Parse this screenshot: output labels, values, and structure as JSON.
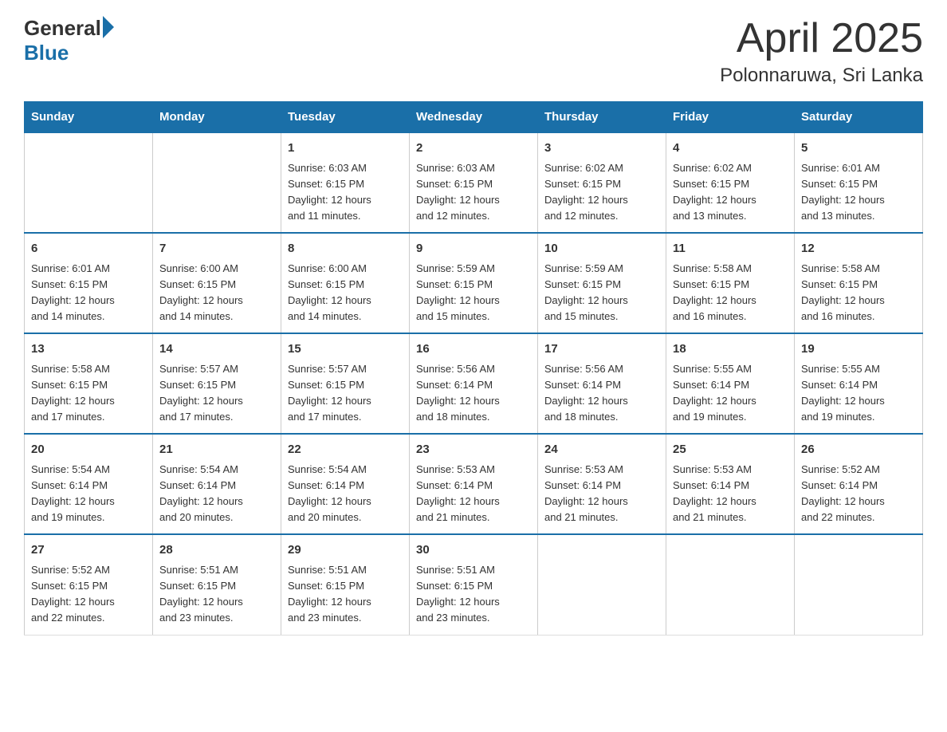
{
  "logo": {
    "text_general": "General",
    "text_blue": "Blue"
  },
  "title": "April 2025",
  "subtitle": "Polonnaruwa, Sri Lanka",
  "days_of_week": [
    "Sunday",
    "Monday",
    "Tuesday",
    "Wednesday",
    "Thursday",
    "Friday",
    "Saturday"
  ],
  "weeks": [
    [
      {
        "day": "",
        "info": ""
      },
      {
        "day": "",
        "info": ""
      },
      {
        "day": "1",
        "info": "Sunrise: 6:03 AM\nSunset: 6:15 PM\nDaylight: 12 hours\nand 11 minutes."
      },
      {
        "day": "2",
        "info": "Sunrise: 6:03 AM\nSunset: 6:15 PM\nDaylight: 12 hours\nand 12 minutes."
      },
      {
        "day": "3",
        "info": "Sunrise: 6:02 AM\nSunset: 6:15 PM\nDaylight: 12 hours\nand 12 minutes."
      },
      {
        "day": "4",
        "info": "Sunrise: 6:02 AM\nSunset: 6:15 PM\nDaylight: 12 hours\nand 13 minutes."
      },
      {
        "day": "5",
        "info": "Sunrise: 6:01 AM\nSunset: 6:15 PM\nDaylight: 12 hours\nand 13 minutes."
      }
    ],
    [
      {
        "day": "6",
        "info": "Sunrise: 6:01 AM\nSunset: 6:15 PM\nDaylight: 12 hours\nand 14 minutes."
      },
      {
        "day": "7",
        "info": "Sunrise: 6:00 AM\nSunset: 6:15 PM\nDaylight: 12 hours\nand 14 minutes."
      },
      {
        "day": "8",
        "info": "Sunrise: 6:00 AM\nSunset: 6:15 PM\nDaylight: 12 hours\nand 14 minutes."
      },
      {
        "day": "9",
        "info": "Sunrise: 5:59 AM\nSunset: 6:15 PM\nDaylight: 12 hours\nand 15 minutes."
      },
      {
        "day": "10",
        "info": "Sunrise: 5:59 AM\nSunset: 6:15 PM\nDaylight: 12 hours\nand 15 minutes."
      },
      {
        "day": "11",
        "info": "Sunrise: 5:58 AM\nSunset: 6:15 PM\nDaylight: 12 hours\nand 16 minutes."
      },
      {
        "day": "12",
        "info": "Sunrise: 5:58 AM\nSunset: 6:15 PM\nDaylight: 12 hours\nand 16 minutes."
      }
    ],
    [
      {
        "day": "13",
        "info": "Sunrise: 5:58 AM\nSunset: 6:15 PM\nDaylight: 12 hours\nand 17 minutes."
      },
      {
        "day": "14",
        "info": "Sunrise: 5:57 AM\nSunset: 6:15 PM\nDaylight: 12 hours\nand 17 minutes."
      },
      {
        "day": "15",
        "info": "Sunrise: 5:57 AM\nSunset: 6:15 PM\nDaylight: 12 hours\nand 17 minutes."
      },
      {
        "day": "16",
        "info": "Sunrise: 5:56 AM\nSunset: 6:14 PM\nDaylight: 12 hours\nand 18 minutes."
      },
      {
        "day": "17",
        "info": "Sunrise: 5:56 AM\nSunset: 6:14 PM\nDaylight: 12 hours\nand 18 minutes."
      },
      {
        "day": "18",
        "info": "Sunrise: 5:55 AM\nSunset: 6:14 PM\nDaylight: 12 hours\nand 19 minutes."
      },
      {
        "day": "19",
        "info": "Sunrise: 5:55 AM\nSunset: 6:14 PM\nDaylight: 12 hours\nand 19 minutes."
      }
    ],
    [
      {
        "day": "20",
        "info": "Sunrise: 5:54 AM\nSunset: 6:14 PM\nDaylight: 12 hours\nand 19 minutes."
      },
      {
        "day": "21",
        "info": "Sunrise: 5:54 AM\nSunset: 6:14 PM\nDaylight: 12 hours\nand 20 minutes."
      },
      {
        "day": "22",
        "info": "Sunrise: 5:54 AM\nSunset: 6:14 PM\nDaylight: 12 hours\nand 20 minutes."
      },
      {
        "day": "23",
        "info": "Sunrise: 5:53 AM\nSunset: 6:14 PM\nDaylight: 12 hours\nand 21 minutes."
      },
      {
        "day": "24",
        "info": "Sunrise: 5:53 AM\nSunset: 6:14 PM\nDaylight: 12 hours\nand 21 minutes."
      },
      {
        "day": "25",
        "info": "Sunrise: 5:53 AM\nSunset: 6:14 PM\nDaylight: 12 hours\nand 21 minutes."
      },
      {
        "day": "26",
        "info": "Sunrise: 5:52 AM\nSunset: 6:14 PM\nDaylight: 12 hours\nand 22 minutes."
      }
    ],
    [
      {
        "day": "27",
        "info": "Sunrise: 5:52 AM\nSunset: 6:15 PM\nDaylight: 12 hours\nand 22 minutes."
      },
      {
        "day": "28",
        "info": "Sunrise: 5:51 AM\nSunset: 6:15 PM\nDaylight: 12 hours\nand 23 minutes."
      },
      {
        "day": "29",
        "info": "Sunrise: 5:51 AM\nSunset: 6:15 PM\nDaylight: 12 hours\nand 23 minutes."
      },
      {
        "day": "30",
        "info": "Sunrise: 5:51 AM\nSunset: 6:15 PM\nDaylight: 12 hours\nand 23 minutes."
      },
      {
        "day": "",
        "info": ""
      },
      {
        "day": "",
        "info": ""
      },
      {
        "day": "",
        "info": ""
      }
    ]
  ]
}
